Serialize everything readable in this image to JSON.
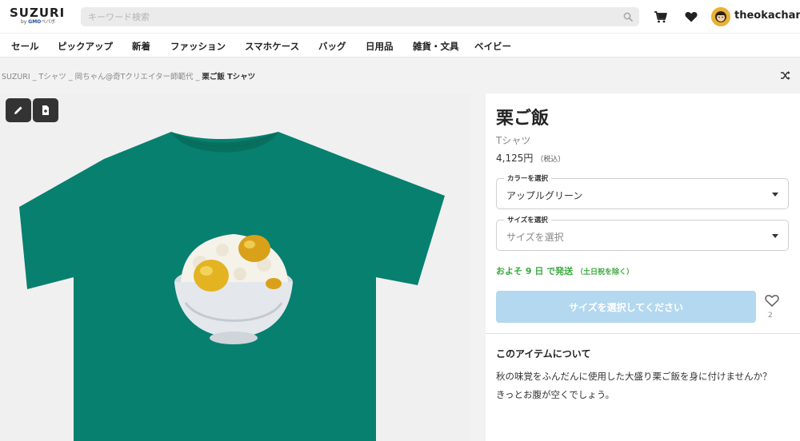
{
  "header": {
    "logo": "SUZURI",
    "logo_sub_prefix": "by",
    "logo_sub_brand": "GMO",
    "logo_sub_suffix": "ペパボ",
    "search_placeholder": "キーワード検索",
    "username": "theokachan"
  },
  "categories": [
    "セール",
    "ピックアップ",
    "新着",
    "ファッション",
    "スマホケース",
    "バッグ",
    "日用品",
    "雑貨・文具",
    "ベイビー"
  ],
  "breadcrumb": {
    "items": [
      "SUZURI",
      "Tシャツ",
      "岡ちゃん@奇Tクリエイター師範代"
    ],
    "separator": "_",
    "current": "栗ご飯 Tシャツ"
  },
  "product": {
    "title": "栗ご飯",
    "category": "Tシャツ",
    "price": "4,125円",
    "tax_note": "（税込）",
    "color_select": {
      "legend": "カラーを選択",
      "value": "アップルグリーン"
    },
    "size_select": {
      "legend": "サイズを選択",
      "placeholder": "サイズを選択"
    },
    "shipping": "およそ 9 日 で発送",
    "shipping_note": "（土日祝を除く）",
    "buy_label": "サイズを選択してください",
    "favorite_count": "2",
    "shirt_color": "#07806f"
  },
  "about": {
    "title": "このアイテムについて",
    "lines": [
      "秋の味覚をふんだんに使用した大盛り栗ご飯を身に付けませんか？",
      "きっとお腹が空くでしょう。"
    ]
  },
  "colors": {
    "accent_green": "#3aa93e",
    "buy_disabled": "#b3d8ef",
    "shirt": "#07806f"
  }
}
